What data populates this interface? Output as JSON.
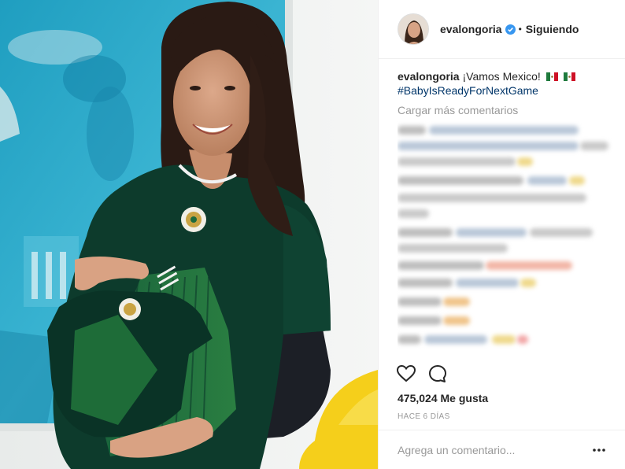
{
  "post": {
    "username": "evalongoria",
    "follow_status": "Siguiendo",
    "caption_username": "evalongoria",
    "caption_text": "¡Vamos Mexico!",
    "hashtag": "#BabyIsReadyForNextGame",
    "load_more": "Cargar más comentarios",
    "likes": "475,024 Me gusta",
    "time": "HACE 6 DÍAS",
    "comment_placeholder": "Agrega un comentario..."
  },
  "colors": {
    "link": "#003569",
    "verified": "#3897f0",
    "muted": "#999999",
    "jersey": "#0d3b2c",
    "sky": "#35aeca"
  },
  "icons": [
    "verified-badge-icon",
    "mexico-flag-icon",
    "heart-icon",
    "comment-bubble-icon",
    "more-options-icon"
  ]
}
